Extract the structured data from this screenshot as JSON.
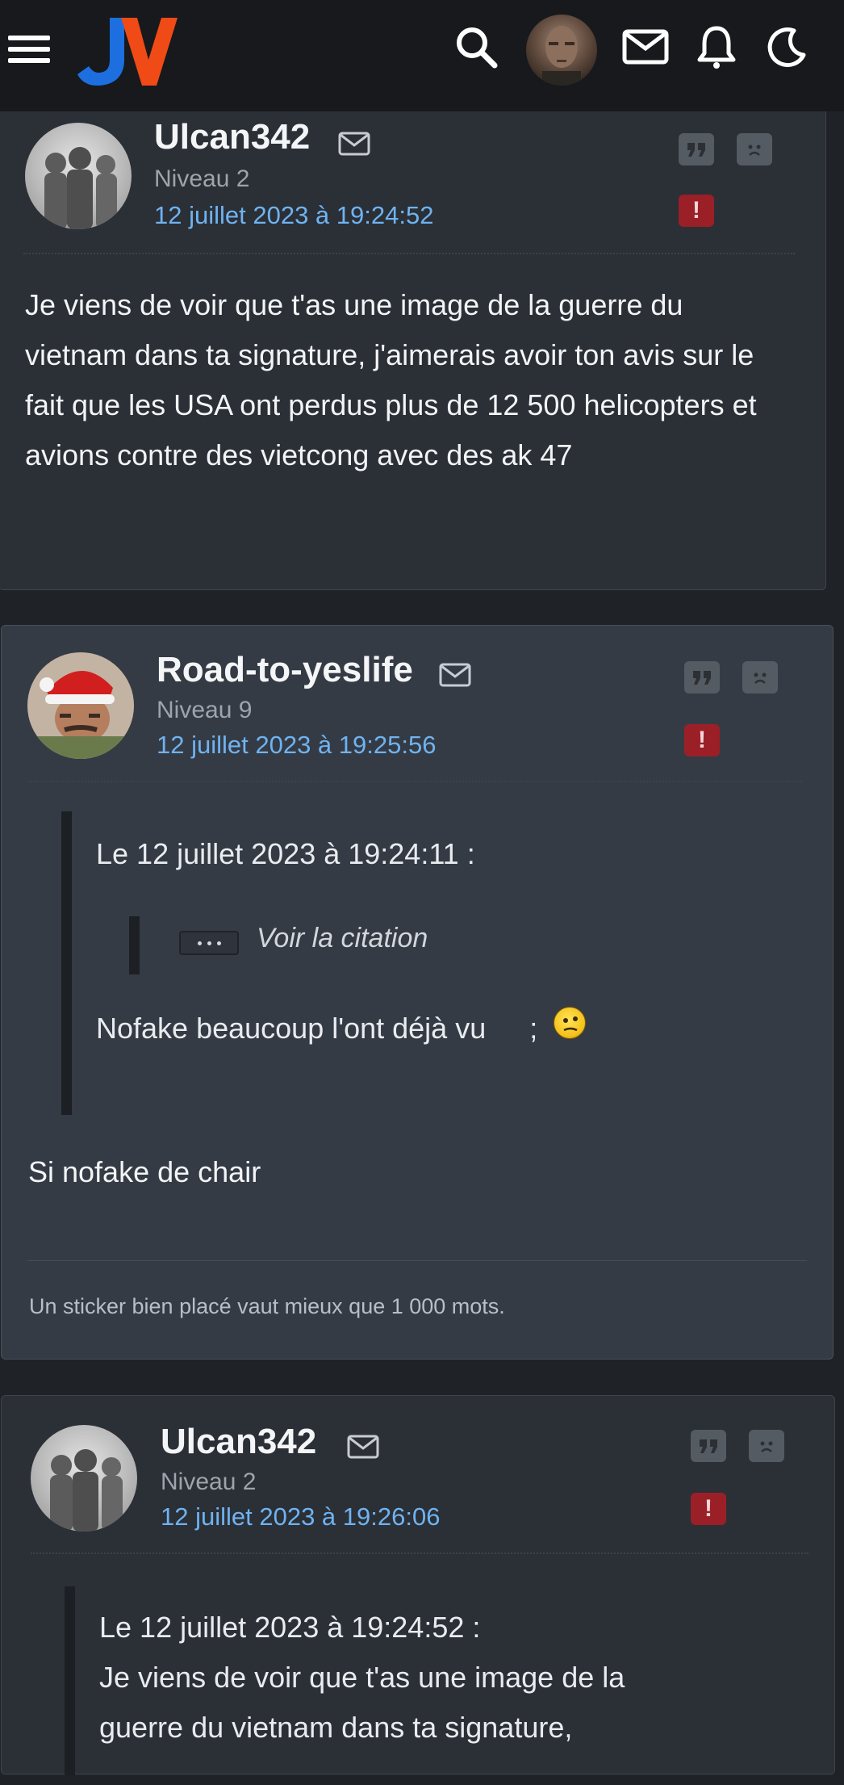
{
  "header": {
    "logo_text": "JV",
    "icons": [
      "menu-icon",
      "search-icon",
      "profile-avatar",
      "mail-icon",
      "bell-icon",
      "moon-icon"
    ]
  },
  "posts": [
    {
      "author": "Ulcan342",
      "level": "Niveau 2",
      "date": "12 juillet 2023 à 19:24:52",
      "body": "Je viens de voir que t'as une image de la guerre du vietnam dans ta signature, j'aimerais avoir ton avis sur le fait que les USA ont perdus plus de 12 500 helicopters et avions contre des vietcong avec des ak 47"
    },
    {
      "author": "Road-to-yeslife",
      "level": "Niveau 9",
      "date": "12 juillet 2023 à 19:25:56",
      "quote_header": "Le 12 juillet 2023 à 19:24:11 :",
      "nested_quote_label": "Voir la citation",
      "quote_text": "Nofake beaucoup l'ont déjà vu",
      "quote_suffix": ";",
      "body": "Si nofake de chair",
      "signature": "Un sticker bien placé vaut mieux que 1 000 mots."
    },
    {
      "author": "Ulcan342",
      "level": "Niveau 2",
      "date": "12 juillet 2023 à 19:26:06",
      "quote_header": "Le 12 juillet 2023 à 19:24:52 :",
      "quote_text_line1": "Je viens de voir que t'as une image de la",
      "quote_text_line2": "guerre du vietnam dans ta signature,"
    }
  ],
  "colors": {
    "accent_link": "#6fb3f1",
    "report_red": "#9b1f27",
    "logo_blue": "#1d6fe0",
    "logo_orange": "#f04a16"
  }
}
